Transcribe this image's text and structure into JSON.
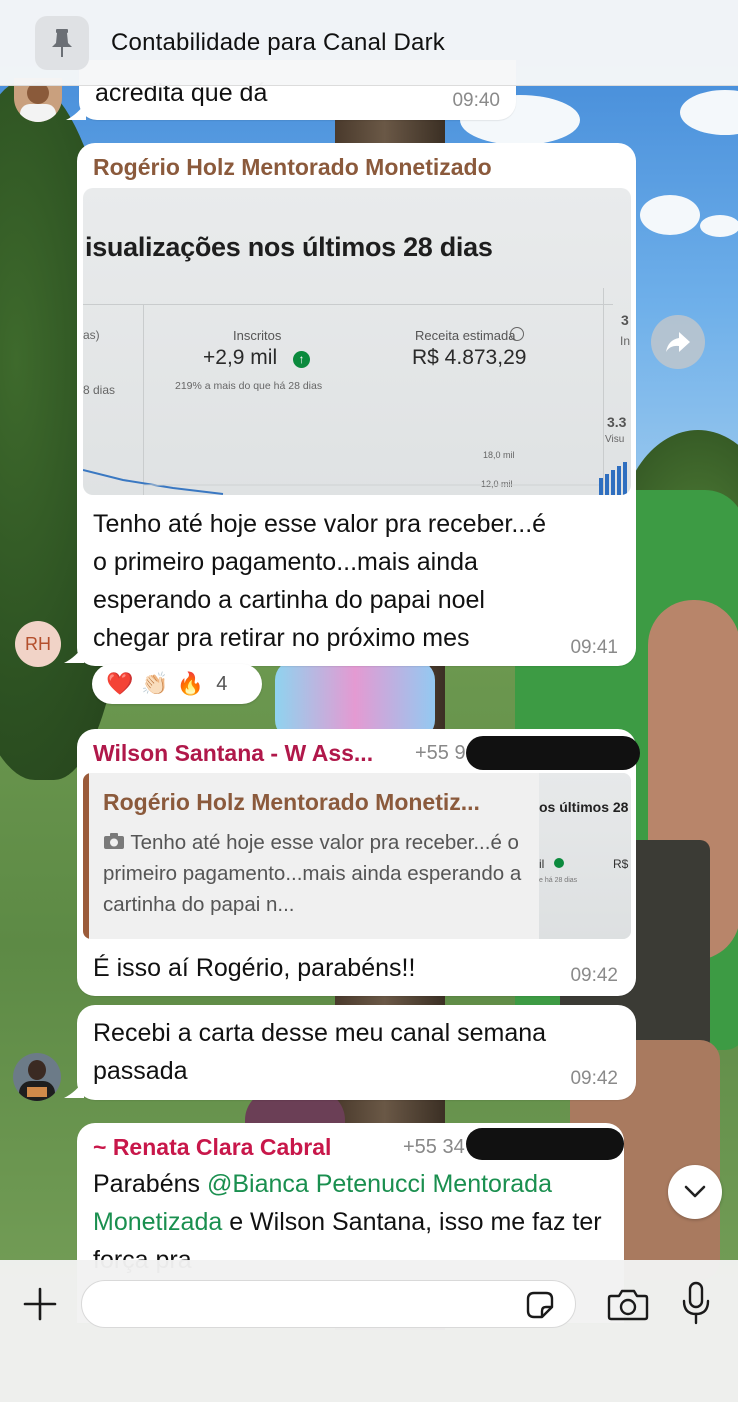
{
  "header": {
    "title": "Contabilidade para Canal Dark"
  },
  "messages": [
    {
      "text": "acredita que dá",
      "time": "09:40"
    },
    {
      "sender": "Rogério Holz Mentorado Monetizado",
      "sender_color": "#8b5a3c",
      "avatar_initials": "RH",
      "image": {
        "title": "isualizações nos últimos 28 dias",
        "left_label": "as)",
        "left_sub": "8 dias",
        "inscritos_label": "Inscritos",
        "inscritos_value": "+2,9 mil",
        "inscritos_sub": "219% a mais do que há 28 dias",
        "receita_label": "Receita estimada",
        "receita_value": "R$ 4.873,29",
        "right_value_1": "3",
        "right_label_1": "In",
        "right_value_2": "3.3",
        "right_label_2": "Visu",
        "axis_1": "18,0 mil",
        "axis_2": "12,0 mil"
      },
      "text": "Tenho até hoje esse valor pra receber...é o primeiro pagamento...mais ainda esperando a cartinha do papai noel chegar pra retirar no próximo mes",
      "time": "09:41",
      "reactions": {
        "emojis": [
          "❤️",
          "👏🏻",
          "🔥"
        ],
        "count": "4"
      }
    },
    {
      "sender": "Wilson Santana - W Ass...",
      "sender_color": "#b0184a",
      "phone": "+55 91",
      "quote": {
        "sender": "Rogério Holz Mentorado Monetiz...",
        "text": "Tenho até hoje esse valor pra receber...é o primeiro pagamento...mais ainda esperando a cartinha do papai n...",
        "thumb_title": "os últimos 28",
        "thumb_value": "il",
        "thumb_right": "R$",
        "thumb_sub": "e há 28 dias"
      },
      "text": "É isso aí Rogério, parabéns!!",
      "time": "09:42"
    },
    {
      "text": "Recebi a carta desse meu canal semana passada",
      "time": "09:42"
    },
    {
      "sender": "~ Renata Clara Cabral",
      "sender_color": "#c8174a",
      "phone": "+55 34",
      "text_before": "Parabéns ",
      "mention": "@Bianca Petenucci Mentorada Monetizada",
      "mention_color": "#1a8f4f",
      "text_after": " e Wilson Santana, isso me faz ter força pra"
    }
  ],
  "input": {
    "placeholder": ""
  },
  "icons": {
    "pin": "pin-icon",
    "forward": "forward-icon",
    "scroll_down": "chevron-down-icon",
    "attach": "plus-icon",
    "sticker": "sticker-icon",
    "camera": "camera-icon",
    "mic": "microphone-icon"
  }
}
